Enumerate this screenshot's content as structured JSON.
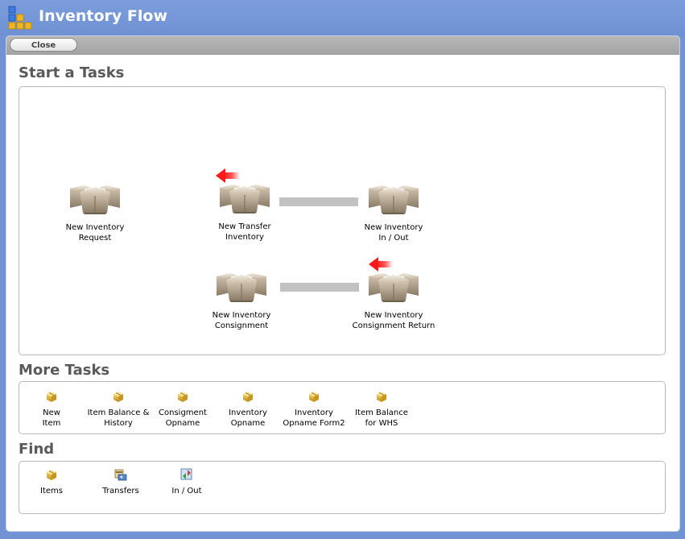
{
  "window": {
    "title": "Inventory Flow"
  },
  "toolbar": {
    "close_label": "Close"
  },
  "start": {
    "title": "Start a Tasks",
    "tasks": [
      {
        "label": "New Inventory\nRequest"
      },
      {
        "label": "New Transfer\nInventory"
      },
      {
        "label": "New Inventory\nIn / Out"
      },
      {
        "label": "New Inventory\nConsignment"
      },
      {
        "label": "New Inventory\nConsignment Return"
      }
    ]
  },
  "more": {
    "title": "More Tasks",
    "items": [
      {
        "label": "New\nItem"
      },
      {
        "label": "Item Balance &\nHistory"
      },
      {
        "label": "Consigment\nOpname"
      },
      {
        "label": "Inventory\nOpname"
      },
      {
        "label": "Inventory\nOpname Form2"
      },
      {
        "label": "Item Balance\nfor WHS"
      }
    ]
  },
  "find": {
    "title": "Find",
    "items": [
      {
        "label": "Items"
      },
      {
        "label": "Transfers"
      },
      {
        "label": "In / Out"
      }
    ]
  },
  "colors": {
    "frame": "#7193d4",
    "section_title": "#595959",
    "connector": "#c2c2c2",
    "arrow": "#ff2a2a"
  }
}
